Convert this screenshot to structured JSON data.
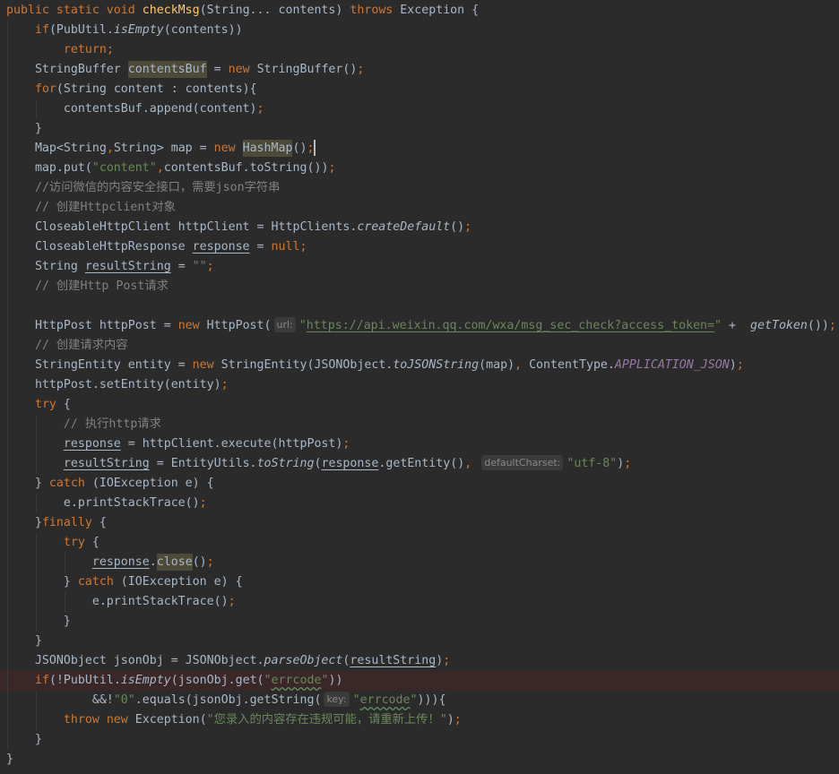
{
  "editor": {
    "theme": {
      "background": "#2b2b2b",
      "text": "#a9b7c6",
      "caret": "#bbbbbb",
      "hint_background": "#3b3b3b",
      "hint_text": "#878787"
    },
    "lines": [
      {
        "tokens": [
          {
            "t": "public static void ",
            "c": "#cc7832"
          },
          {
            "t": "checkMsg",
            "c": "#ffc66d"
          },
          {
            "t": "(String... contents) "
          },
          {
            "t": "throws ",
            "c": "#cc7832"
          },
          {
            "t": "Exception {"
          }
        ]
      },
      {
        "tokens": [
          {
            "t": "    "
          },
          {
            "t": "if",
            "c": "#cc7832"
          },
          {
            "t": "(PubUtil."
          },
          {
            "t": "isEmpty",
            "i": true
          },
          {
            "t": "(contents))"
          }
        ]
      },
      {
        "tokens": [
          {
            "t": "        "
          },
          {
            "t": "return;",
            "c": "#cc7832"
          }
        ]
      },
      {
        "tokens": [
          {
            "t": "    StringBuffer "
          },
          {
            "t": "contentsBuf",
            "bg": "#4d4b38"
          },
          {
            "t": " = "
          },
          {
            "t": "new",
            "c": "#cc7832"
          },
          {
            "t": " StringBuffer()"
          },
          {
            "t": ";",
            "c": "#cc7832"
          }
        ]
      },
      {
        "tokens": [
          {
            "t": "    "
          },
          {
            "t": "for",
            "c": "#cc7832"
          },
          {
            "t": "(String content : contents){"
          }
        ]
      },
      {
        "tokens": [
          {
            "t": "        contentsBuf.append(content)"
          },
          {
            "t": ";",
            "c": "#cc7832"
          }
        ]
      },
      {
        "tokens": [
          {
            "t": "    }"
          }
        ]
      },
      {
        "tokens": [
          {
            "t": "    Map<String"
          },
          {
            "t": ",",
            "c": "#cc7832"
          },
          {
            "t": "String> map = "
          },
          {
            "t": "new ",
            "c": "#cc7832"
          },
          {
            "t": "HashMap",
            "bg": "#4d4b38"
          },
          {
            "t": "()"
          },
          {
            "t": ";",
            "c": "#cc7832"
          },
          {
            "caret": true
          }
        ]
      },
      {
        "tokens": [
          {
            "t": "    map.put("
          },
          {
            "t": "\"content\"",
            "c": "#6a8759"
          },
          {
            "t": ",",
            "c": "#cc7832"
          },
          {
            "t": "contentsBuf.toString())"
          },
          {
            "t": ";",
            "c": "#cc7832"
          }
        ]
      },
      {
        "tokens": [
          {
            "t": "    "
          },
          {
            "t": "//访问微信的内容安全接口，需要json字符串",
            "c": "#808080"
          }
        ]
      },
      {
        "tokens": [
          {
            "t": "    "
          },
          {
            "t": "// 创建Httpclient对象",
            "c": "#808080"
          }
        ]
      },
      {
        "tokens": [
          {
            "t": "    CloseableHttpClient httpClient = HttpClients."
          },
          {
            "t": "createDefault",
            "i": true
          },
          {
            "t": "()"
          },
          {
            "t": ";",
            "c": "#cc7832"
          }
        ]
      },
      {
        "tokens": [
          {
            "t": "    CloseableHttpResponse "
          },
          {
            "t": "response",
            "u": true
          },
          {
            "t": " = "
          },
          {
            "t": "null;",
            "c": "#cc7832"
          }
        ]
      },
      {
        "tokens": [
          {
            "t": "    String "
          },
          {
            "t": "resultString",
            "u": true
          },
          {
            "t": " = "
          },
          {
            "t": "\"\"",
            "c": "#6a8759"
          },
          {
            "t": ";",
            "c": "#cc7832"
          }
        ]
      },
      {
        "tokens": [
          {
            "t": "    "
          },
          {
            "t": "// 创建Http Post请求",
            "c": "#808080"
          }
        ]
      },
      {
        "tokens": []
      },
      {
        "tokens": [
          {
            "t": "    HttpPost httpPost = "
          },
          {
            "t": "new",
            "c": "#cc7832"
          },
          {
            "t": " HttpPost("
          },
          {
            "t": "url:",
            "hint": true
          },
          {
            "t": "\"",
            "c": "#6a8759"
          },
          {
            "t": "https://api.weixin.qq.com/wxa/msg_sec_check?access_token=",
            "c": "#6a8759",
            "u": true
          },
          {
            "t": "\"",
            "c": "#6a8759"
          },
          {
            "t": " +  "
          },
          {
            "t": "getToken",
            "i": true
          },
          {
            "t": "())"
          },
          {
            "t": ";",
            "c": "#cc7832"
          }
        ]
      },
      {
        "tokens": [
          {
            "t": "    "
          },
          {
            "t": "// 创建请求内容",
            "c": "#808080"
          }
        ]
      },
      {
        "tokens": [
          {
            "t": "    StringEntity entity = "
          },
          {
            "t": "new",
            "c": "#cc7832"
          },
          {
            "t": " StringEntity(JSONObject."
          },
          {
            "t": "toJSONString",
            "i": true
          },
          {
            "t": "(map)"
          },
          {
            "t": ",",
            "c": "#cc7832"
          },
          {
            "t": " ContentType."
          },
          {
            "t": "APPLICATION_JSON",
            "c": "#9876aa",
            "i": true
          },
          {
            "t": ")"
          },
          {
            "t": ";",
            "c": "#cc7832"
          }
        ]
      },
      {
        "tokens": [
          {
            "t": "    httpPost.setEntity(entity)"
          },
          {
            "t": ";",
            "c": "#cc7832"
          }
        ]
      },
      {
        "tokens": [
          {
            "t": "    "
          },
          {
            "t": "try",
            "c": "#cc7832"
          },
          {
            "t": " {"
          }
        ]
      },
      {
        "tokens": [
          {
            "t": "        "
          },
          {
            "t": "// 执行http请求",
            "c": "#808080"
          }
        ]
      },
      {
        "tokens": [
          {
            "t": "        "
          },
          {
            "t": "response",
            "u": true
          },
          {
            "t": " = httpClient.execute(httpPost)"
          },
          {
            "t": ";",
            "c": "#cc7832"
          }
        ]
      },
      {
        "tokens": [
          {
            "t": "        "
          },
          {
            "t": "resultString",
            "u": true
          },
          {
            "t": " = EntityUtils."
          },
          {
            "t": "toString",
            "i": true
          },
          {
            "t": "("
          },
          {
            "t": "response",
            "u": true
          },
          {
            "t": ".getEntity()"
          },
          {
            "t": ",",
            "c": "#cc7832"
          },
          {
            "t": " "
          },
          {
            "t": "defaultCharset:",
            "hint": true
          },
          {
            "t": "\"utf-8\"",
            "c": "#6a8759"
          },
          {
            "t": ")"
          },
          {
            "t": ";",
            "c": "#cc7832"
          }
        ]
      },
      {
        "tokens": [
          {
            "t": "    } "
          },
          {
            "t": "catch",
            "c": "#cc7832"
          },
          {
            "t": " (IOException e) {"
          }
        ]
      },
      {
        "tokens": [
          {
            "t": "        e.printStackTrace()"
          },
          {
            "t": ";",
            "c": "#cc7832"
          }
        ]
      },
      {
        "tokens": [
          {
            "t": "    }"
          },
          {
            "t": "finally",
            "c": "#cc7832"
          },
          {
            "t": " {"
          }
        ]
      },
      {
        "tokens": [
          {
            "t": "        "
          },
          {
            "t": "try",
            "c": "#cc7832"
          },
          {
            "t": " {"
          }
        ]
      },
      {
        "tokens": [
          {
            "t": "            "
          },
          {
            "t": "response",
            "u": true
          },
          {
            "t": "."
          },
          {
            "t": "close",
            "bg": "#4d4b38"
          },
          {
            "t": "()"
          },
          {
            "t": ";",
            "c": "#cc7832"
          }
        ]
      },
      {
        "tokens": [
          {
            "t": "        } "
          },
          {
            "t": "catch",
            "c": "#cc7832"
          },
          {
            "t": " (IOException e) {"
          }
        ]
      },
      {
        "tokens": [
          {
            "t": "            e.printStackTrace()"
          },
          {
            "t": ";",
            "c": "#cc7832"
          }
        ]
      },
      {
        "tokens": [
          {
            "t": "        }"
          }
        ]
      },
      {
        "tokens": [
          {
            "t": "    }"
          }
        ]
      },
      {
        "tokens": [
          {
            "t": "    JSONObject jsonObj = JSONObject."
          },
          {
            "t": "parseObject",
            "i": true
          },
          {
            "t": "("
          },
          {
            "t": "resultString",
            "u": true
          },
          {
            "t": ")"
          },
          {
            "t": ";",
            "c": "#cc7832"
          }
        ]
      },
      {
        "bg": "#3a2727",
        "tokens": [
          {
            "t": "    "
          },
          {
            "t": "if",
            "c": "#cc7832"
          },
          {
            "t": "(!PubUtil."
          },
          {
            "t": "isEmpty",
            "i": true
          },
          {
            "t": "(jsonObj.get("
          },
          {
            "t": "\"",
            "c": "#6a8759"
          },
          {
            "t": "errcode",
            "c": "#6a8759",
            "typo": true
          },
          {
            "t": "\"",
            "c": "#6a8759"
          },
          {
            "t": "))"
          }
        ]
      },
      {
        "tokens": [
          {
            "t": "            &&!"
          },
          {
            "t": "\"0\"",
            "c": "#6a8759"
          },
          {
            "t": ".equals(jsonObj.getString("
          },
          {
            "t": "key:",
            "hint": true
          },
          {
            "t": "\"",
            "c": "#6a8759"
          },
          {
            "t": "errcode",
            "c": "#6a8759",
            "typo": true
          },
          {
            "t": "\"",
            "c": "#6a8759"
          },
          {
            "t": "))){"
          }
        ]
      },
      {
        "tokens": [
          {
            "t": "        "
          },
          {
            "t": "throw new ",
            "c": "#cc7832"
          },
          {
            "t": "Exception("
          },
          {
            "t": "\"您录入的内容存在违规可能，请重新上传！\"",
            "c": "#6a8759"
          },
          {
            "t": ")"
          },
          {
            "t": ";",
            "c": "#cc7832"
          }
        ]
      },
      {
        "tokens": [
          {
            "t": "    }"
          }
        ]
      },
      {
        "tokens": [
          {
            "t": "}"
          }
        ]
      }
    ]
  }
}
